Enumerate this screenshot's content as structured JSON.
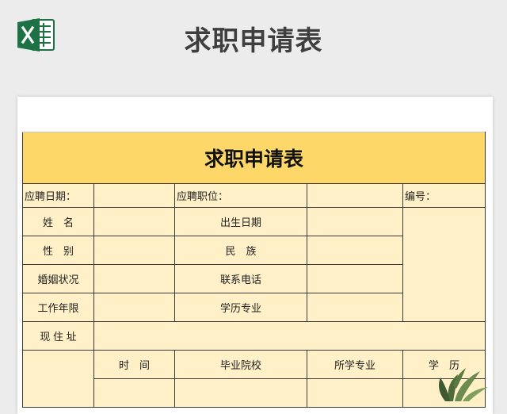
{
  "page": {
    "title": "求职申请表",
    "logo_icon": "excel-icon",
    "accent_color": "#fdd767",
    "cell_color": "#fff0c8"
  },
  "form": {
    "title": "求职申请表",
    "apply_date_label": "应聘日期：",
    "apply_position_label": "应聘职位：",
    "number_label": "编号：",
    "name_label": "姓　名",
    "birth_date_label": "出生日期",
    "gender_label": "性　别",
    "ethnicity_label": "民　族",
    "marital_status_label": "婚姻状况",
    "phone_label": "联系电话",
    "work_years_label": "工作年限",
    "education_major_label": "学历专业",
    "address_label": "现 住 址",
    "education_table": {
      "headers": [
        "时　间",
        "毕业院校",
        "所学专业",
        "学　历"
      ]
    }
  }
}
